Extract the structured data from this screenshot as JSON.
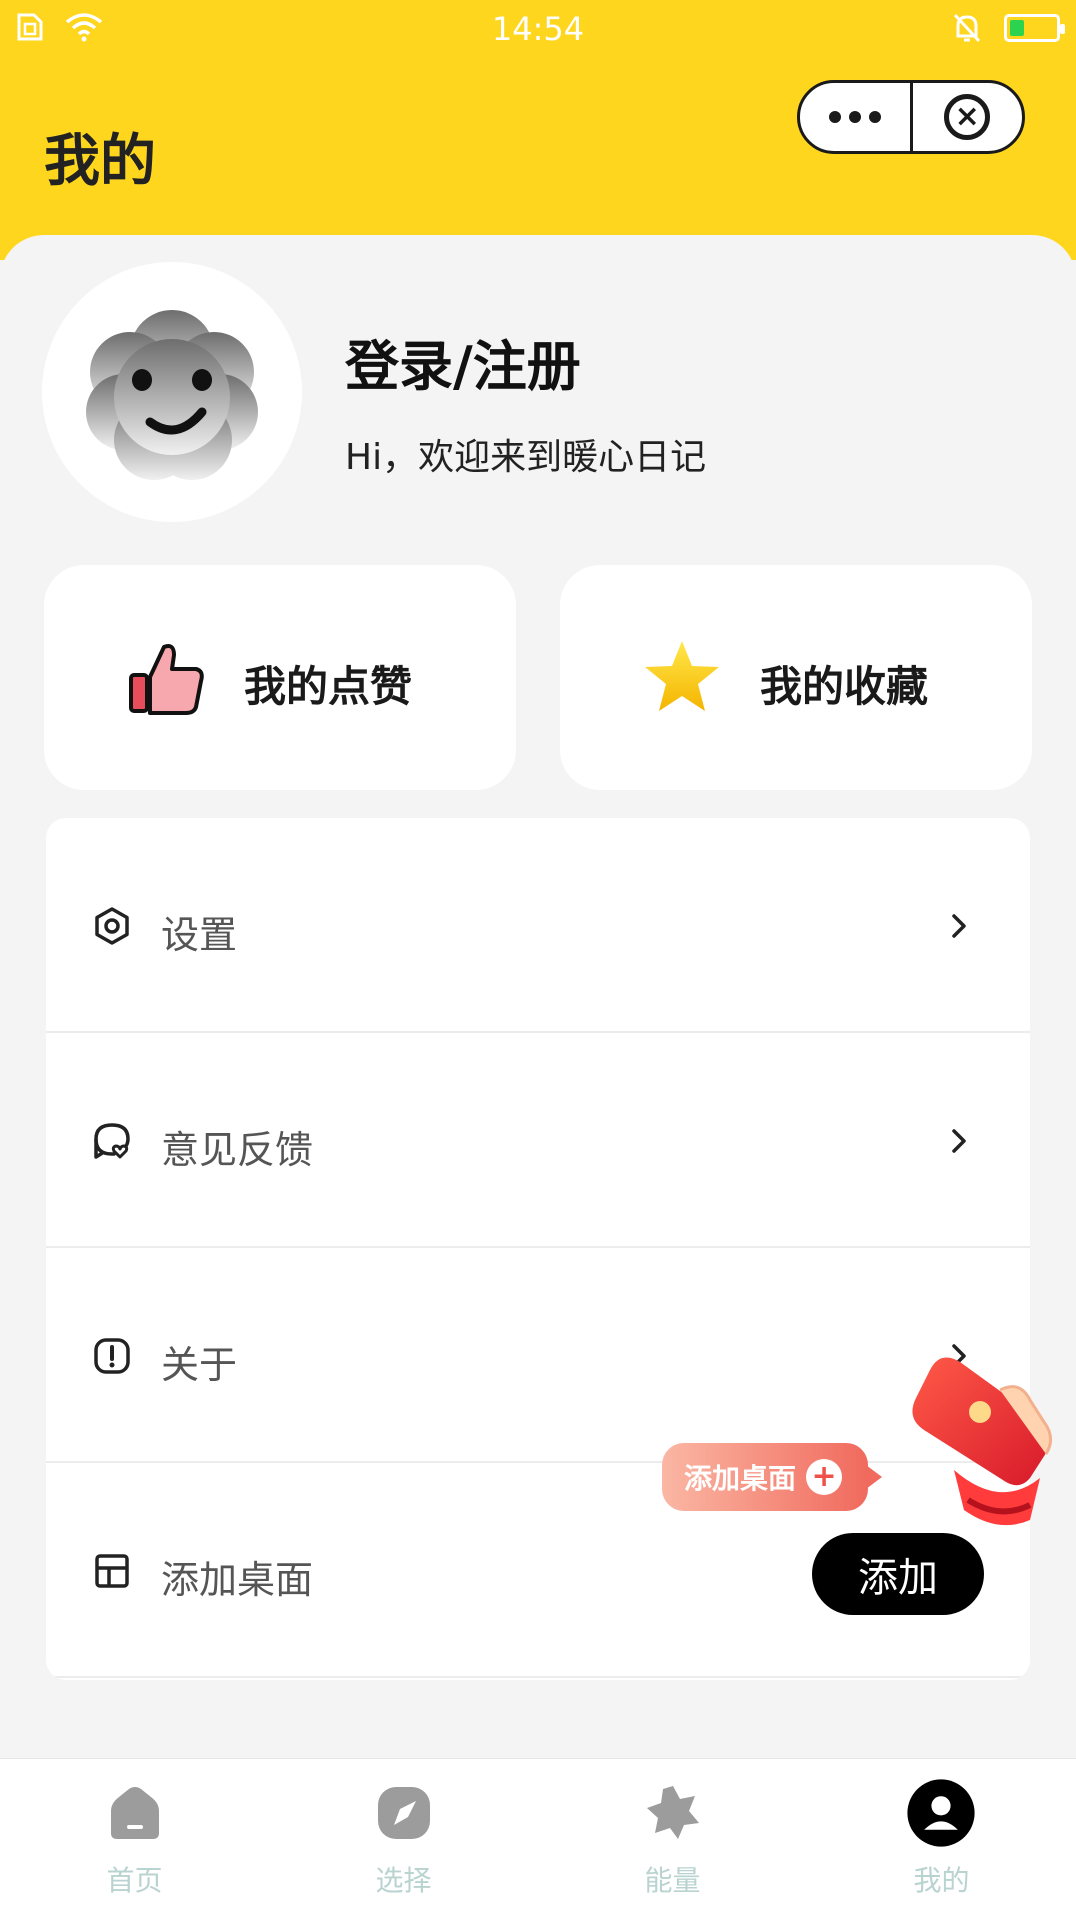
{
  "status": {
    "time": "14:54"
  },
  "header": {
    "title": "我的"
  },
  "profile": {
    "login_label": "登录/注册",
    "welcome": "Hi，欢迎来到暖心日记"
  },
  "cards": [
    {
      "label": "我的点赞",
      "icon": "thumbs-up-icon"
    },
    {
      "label": "我的收藏",
      "icon": "star-icon"
    }
  ],
  "menu": [
    {
      "label": "设置",
      "icon": "settings-hexagon-icon"
    },
    {
      "label": "意见反馈",
      "icon": "feedback-bubble-icon"
    },
    {
      "label": "关于",
      "icon": "info-exclamation-icon"
    },
    {
      "label": "添加桌面",
      "icon": "desktop-grid-icon"
    }
  ],
  "add_button": {
    "label": "添加"
  },
  "promo": {
    "label": "添加桌面"
  },
  "tabs": [
    {
      "label": "首页",
      "icon": "home-icon"
    },
    {
      "label": "选择",
      "icon": "compass-icon"
    },
    {
      "label": "能量",
      "icon": "star-burst-icon"
    },
    {
      "label": "我的",
      "icon": "user-icon"
    }
  ],
  "colors": {
    "header": "#ffd61e",
    "background": "#f4f4f4",
    "tab_label": "#b9d3d0",
    "battery": "#2bd34e"
  }
}
